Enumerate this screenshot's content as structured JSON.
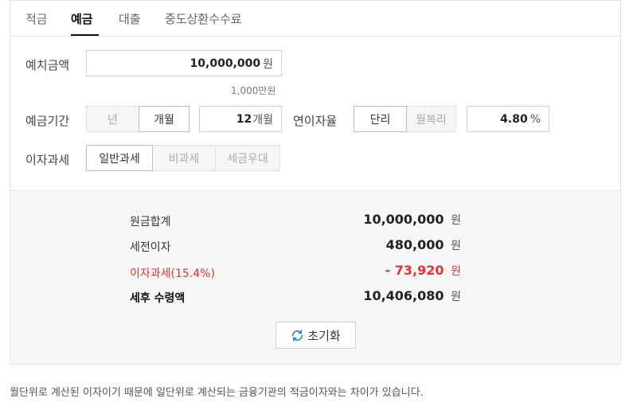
{
  "tabs": [
    {
      "label": "적금"
    },
    {
      "label": "예금"
    },
    {
      "label": "대출"
    },
    {
      "label": "중도상환수수료"
    }
  ],
  "form": {
    "deposit_label": "예치금액",
    "deposit_value": "10,000,000",
    "deposit_unit": "원",
    "deposit_hint": "1,000만원",
    "period_label": "예금기간",
    "period_units": [
      "년",
      "개월"
    ],
    "period_unit_selected": "개월",
    "period_value": "12",
    "period_value_unit": "개월",
    "rate_label": "연이자율",
    "rate_types": [
      "단리",
      "월복리"
    ],
    "rate_type_selected": "단리",
    "rate_value": "4.80",
    "rate_unit": "%",
    "tax_label": "이자과세",
    "tax_types": [
      "일반과세",
      "비과세",
      "세금우대"
    ],
    "tax_type_selected": "일반과세"
  },
  "results": {
    "principal_label": "원금합계",
    "principal_value": "10,000,000",
    "interest_label": "세전이자",
    "interest_value": "480,000",
    "tax_label": "이자과세(15.4%)",
    "tax_value": "- 73,920",
    "net_label": "세후 수령액",
    "net_value": "10,406,080",
    "unit": "원"
  },
  "reset": {
    "label": "초기화",
    "icon": "refresh-icon"
  },
  "footnote": "월단위로 계산된 이자이기 때문에 일단위로 계산되는 금융기관의 적금이자와는 차이가 있습니다.",
  "colors": {
    "accent_red": "#e8302f",
    "active_tab": "#111111"
  }
}
